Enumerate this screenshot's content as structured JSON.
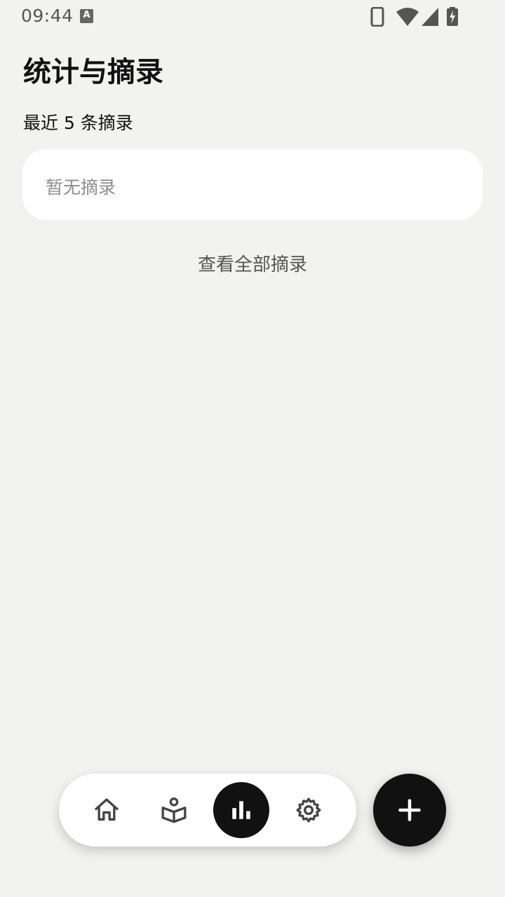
{
  "status_bar": {
    "time": "09:44",
    "notification_icon_letter": "A",
    "icons": [
      "phone-icon",
      "wifi-icon",
      "signal-icon",
      "battery-charging-icon"
    ]
  },
  "header": {
    "title": "统计与摘录"
  },
  "recent": {
    "label": "最近 5 条摘录",
    "empty_text": "暂无摘录",
    "view_all_label": "查看全部摘录"
  },
  "bottom_nav": {
    "items": [
      {
        "icon": "home-icon",
        "active": false
      },
      {
        "icon": "reading-icon",
        "active": false
      },
      {
        "icon": "stats-icon",
        "active": true
      },
      {
        "icon": "settings-icon",
        "active": false
      }
    ],
    "fab_icon": "plus-icon"
  },
  "colors": {
    "background": "#f2f2f0",
    "card": "#ffffff",
    "accent": "#111111",
    "muted_text": "#8e8e8e"
  }
}
